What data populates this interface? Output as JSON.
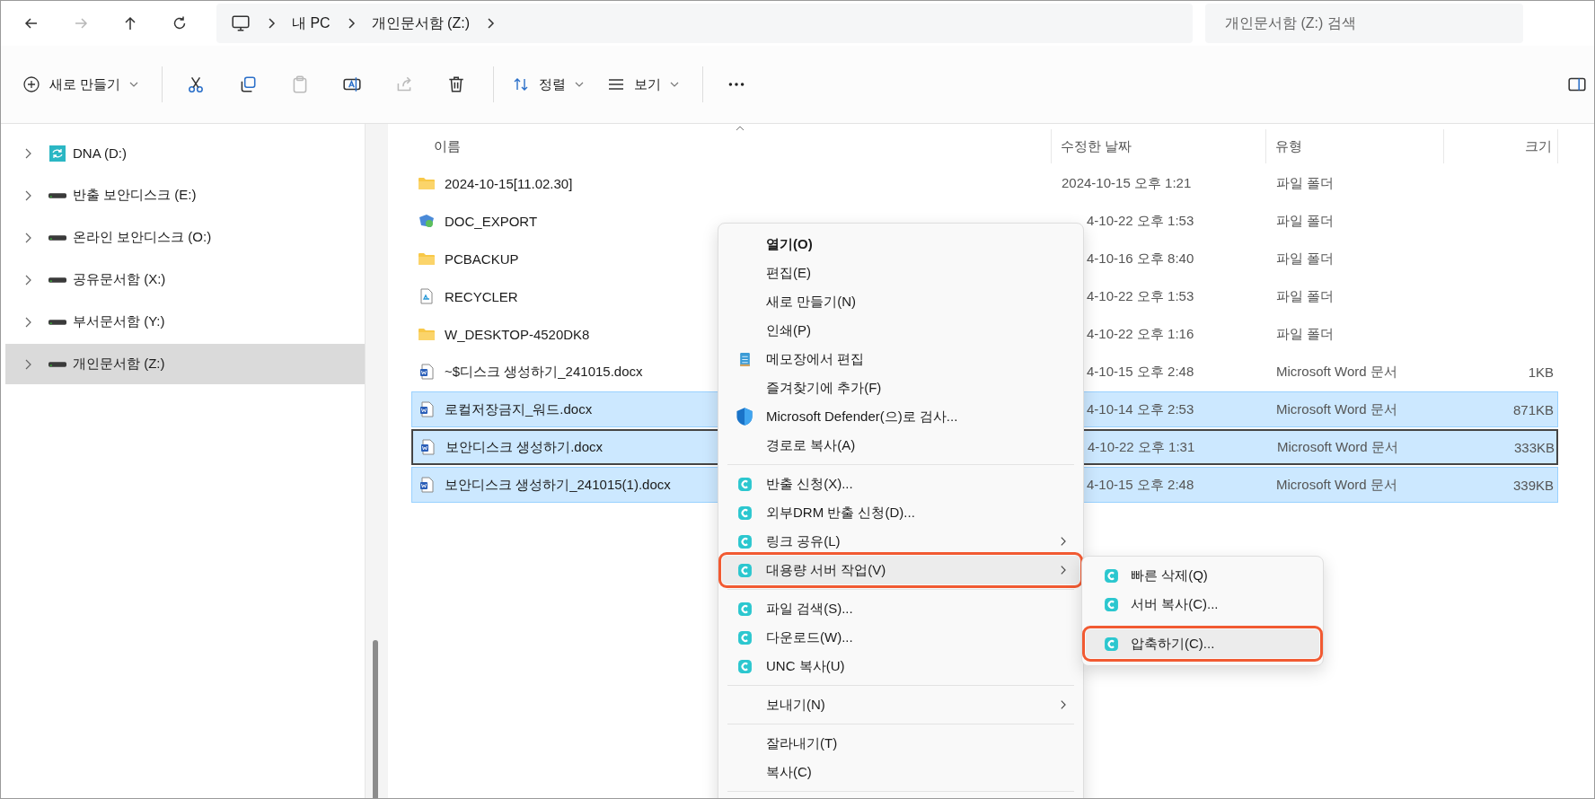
{
  "nav": {
    "forward_disabled": true
  },
  "breadcrumb": [
    "내 PC",
    "개인문서함 (Z:)"
  ],
  "search": {
    "placeholder": "개인문서함 (Z:) 검색"
  },
  "toolbar": {
    "new_label": "새로 만들기",
    "paste_disabled": true,
    "share_disabled": true,
    "sort_label": "정렬",
    "view_label": "보기"
  },
  "sidebar": {
    "items": [
      {
        "label": "DNA (D:)",
        "kind": "sync",
        "selected": false
      },
      {
        "label": "반출 보안디스크 (E:)",
        "kind": "drive",
        "selected": false
      },
      {
        "label": "온라인 보안디스크 (O:)",
        "kind": "drive",
        "selected": false
      },
      {
        "label": "공유문서함 (X:)",
        "kind": "drive",
        "selected": false
      },
      {
        "label": "부서문서함 (Y:)",
        "kind": "drive",
        "selected": false
      },
      {
        "label": "개인문서함 (Z:)",
        "kind": "drive",
        "selected": true
      }
    ]
  },
  "table": {
    "columns": [
      "이름",
      "수정한 날짜",
      "유형",
      "크기"
    ],
    "rows": [
      {
        "kind": "folder",
        "name": "2024-10-15[11.02.30]",
        "date": "2024-10-15 오후 1:21",
        "date_covered": false,
        "type": "파일 폴더",
        "selected": false,
        "focused": false
      },
      {
        "kind": "special",
        "name": "DOC_EXPORT",
        "date": "4-10-22 오후 1:53",
        "date_covered": true,
        "type": "파일 폴더",
        "selected": false,
        "focused": false
      },
      {
        "kind": "folder",
        "name": "PCBACKUP",
        "date": "4-10-16 오후 8:40",
        "date_covered": true,
        "type": "파일 폴더",
        "selected": false,
        "focused": false
      },
      {
        "kind": "recycle",
        "name": "RECYCLER",
        "date": "4-10-22 오후 1:53",
        "date_covered": true,
        "type": "파일 폴더",
        "selected": false,
        "focused": false
      },
      {
        "kind": "folder",
        "name": "W_DESKTOP-4520DK8",
        "date": "4-10-22 오후 1:16",
        "date_covered": true,
        "type": "파일 폴더",
        "selected": false,
        "focused": false
      },
      {
        "kind": "document",
        "name": "~$디스크 생성하기_241015.docx",
        "date": "4-10-15 오후 2:48",
        "date_covered": true,
        "type": "Microsoft Word 문서",
        "size": "1KB",
        "selected": false,
        "focused": false
      },
      {
        "kind": "document",
        "name": "로컬저장금지_워드.docx",
        "date": "4-10-14 오후 2:53",
        "date_covered": true,
        "type": "Microsoft Word 문서",
        "size": "871KB",
        "selected": true,
        "focused": false
      },
      {
        "kind": "document",
        "name": "보안디스크 생성하기.docx",
        "date": "4-10-22 오후 1:31",
        "date_covered": true,
        "type": "Microsoft Word 문서",
        "size": "333KB",
        "selected": true,
        "focused": true
      },
      {
        "kind": "document",
        "name": "보안디스크 생성하기_241015(1).docx",
        "date": "4-10-15 오후 2:48",
        "date_covered": true,
        "type": "Microsoft Word 문서",
        "size": "339KB",
        "selected": true,
        "focused": false
      }
    ]
  },
  "context_menu": {
    "items": [
      {
        "kind": "plain",
        "label": "열기(O)",
        "default": true,
        "has_submenu": false,
        "highlighted": false
      },
      {
        "kind": "plain",
        "label": "편집(E)",
        "default": false,
        "has_submenu": false,
        "highlighted": false
      },
      {
        "kind": "plain",
        "label": "새로 만들기(N)",
        "default": false,
        "has_submenu": false,
        "highlighted": false
      },
      {
        "kind": "plain",
        "label": "인쇄(P)",
        "default": false,
        "has_submenu": false,
        "highlighted": false
      },
      {
        "kind": "notepad",
        "label": "메모장에서 편집",
        "default": false,
        "has_submenu": false,
        "highlighted": false
      },
      {
        "kind": "plain",
        "label": "즐겨찾기에 추가(F)",
        "default": false,
        "has_submenu": false,
        "highlighted": false
      },
      {
        "kind": "shield",
        "label": "Microsoft Defender(으)로 검사...",
        "default": false,
        "has_submenu": false,
        "highlighted": false
      },
      {
        "kind": "plain",
        "label": "경로로 복사(A)",
        "default": false,
        "has_submenu": false,
        "highlighted": false
      },
      {
        "kind": "separator"
      },
      {
        "kind": "app",
        "label": "반출 신청(X)...",
        "default": false,
        "has_submenu": false,
        "highlighted": false
      },
      {
        "kind": "app",
        "label": "외부DRM 반출 신청(D)...",
        "default": false,
        "has_submenu": false,
        "highlighted": false
      },
      {
        "kind": "app",
        "label": "링크 공유(L)",
        "default": false,
        "has_submenu": true,
        "highlighted": false
      },
      {
        "kind": "app",
        "label": "대용량 서버 작업(V)",
        "default": false,
        "has_submenu": true,
        "highlighted": true
      },
      {
        "kind": "separator"
      },
      {
        "kind": "app",
        "label": "파일 검색(S)...",
        "default": false,
        "has_submenu": false,
        "highlighted": false
      },
      {
        "kind": "app",
        "label": "다운로드(W)...",
        "default": false,
        "has_submenu": false,
        "highlighted": false
      },
      {
        "kind": "app",
        "label": "UNC 복사(U)",
        "default": false,
        "has_submenu": false,
        "highlighted": false
      },
      {
        "kind": "separator"
      },
      {
        "kind": "plain",
        "label": "보내기(N)",
        "default": false,
        "has_submenu": true,
        "highlighted": false
      },
      {
        "kind": "separator"
      },
      {
        "kind": "plain",
        "label": "잘라내기(T)",
        "default": false,
        "has_submenu": false,
        "highlighted": false
      },
      {
        "kind": "plain",
        "label": "복사(C)",
        "default": false,
        "has_submenu": false,
        "highlighted": false
      },
      {
        "kind": "separator"
      }
    ]
  },
  "submenu": {
    "items": [
      {
        "label": "빠른 삭제(Q)",
        "highlighted": false
      },
      {
        "label": "서버 복사(C)...",
        "highlighted": false
      },
      {
        "label": "압축하기(C)...",
        "highlighted": true
      }
    ]
  }
}
